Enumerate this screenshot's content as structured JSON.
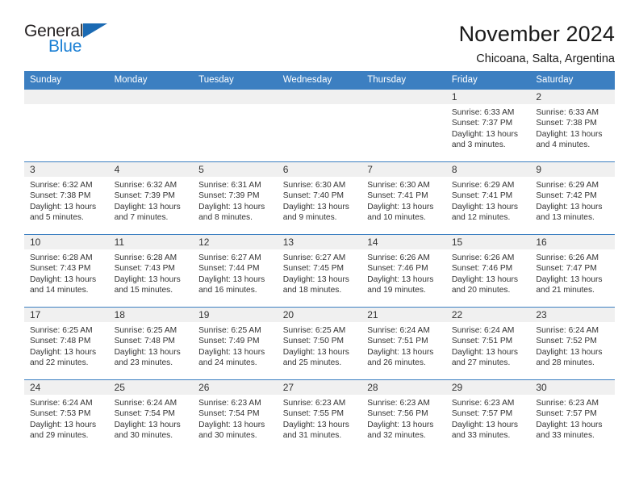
{
  "logo": {
    "word1": "General",
    "word2": "Blue",
    "triangle_color": "#1b6ab3",
    "blue_text_color": "#1a7fd4"
  },
  "header": {
    "title": "November 2024",
    "subtitle": "Chicoana, Salta, Argentina"
  },
  "theme": {
    "header_blue": "#3c7fc1",
    "daynum_gray": "#f0f0f0",
    "text": "#333333"
  },
  "weekdays": [
    "Sunday",
    "Monday",
    "Tuesday",
    "Wednesday",
    "Thursday",
    "Friday",
    "Saturday"
  ],
  "weeks": [
    [
      {
        "day": "",
        "sunrise": "",
        "sunset": "",
        "daylight": ""
      },
      {
        "day": "",
        "sunrise": "",
        "sunset": "",
        "daylight": ""
      },
      {
        "day": "",
        "sunrise": "",
        "sunset": "",
        "daylight": ""
      },
      {
        "day": "",
        "sunrise": "",
        "sunset": "",
        "daylight": ""
      },
      {
        "day": "",
        "sunrise": "",
        "sunset": "",
        "daylight": ""
      },
      {
        "day": "1",
        "sunrise": "Sunrise: 6:33 AM",
        "sunset": "Sunset: 7:37 PM",
        "daylight": "Daylight: 13 hours and 3 minutes."
      },
      {
        "day": "2",
        "sunrise": "Sunrise: 6:33 AM",
        "sunset": "Sunset: 7:38 PM",
        "daylight": "Daylight: 13 hours and 4 minutes."
      }
    ],
    [
      {
        "day": "3",
        "sunrise": "Sunrise: 6:32 AM",
        "sunset": "Sunset: 7:38 PM",
        "daylight": "Daylight: 13 hours and 5 minutes."
      },
      {
        "day": "4",
        "sunrise": "Sunrise: 6:32 AM",
        "sunset": "Sunset: 7:39 PM",
        "daylight": "Daylight: 13 hours and 7 minutes."
      },
      {
        "day": "5",
        "sunrise": "Sunrise: 6:31 AM",
        "sunset": "Sunset: 7:39 PM",
        "daylight": "Daylight: 13 hours and 8 minutes."
      },
      {
        "day": "6",
        "sunrise": "Sunrise: 6:30 AM",
        "sunset": "Sunset: 7:40 PM",
        "daylight": "Daylight: 13 hours and 9 minutes."
      },
      {
        "day": "7",
        "sunrise": "Sunrise: 6:30 AM",
        "sunset": "Sunset: 7:41 PM",
        "daylight": "Daylight: 13 hours and 10 minutes."
      },
      {
        "day": "8",
        "sunrise": "Sunrise: 6:29 AM",
        "sunset": "Sunset: 7:41 PM",
        "daylight": "Daylight: 13 hours and 12 minutes."
      },
      {
        "day": "9",
        "sunrise": "Sunrise: 6:29 AM",
        "sunset": "Sunset: 7:42 PM",
        "daylight": "Daylight: 13 hours and 13 minutes."
      }
    ],
    [
      {
        "day": "10",
        "sunrise": "Sunrise: 6:28 AM",
        "sunset": "Sunset: 7:43 PM",
        "daylight": "Daylight: 13 hours and 14 minutes."
      },
      {
        "day": "11",
        "sunrise": "Sunrise: 6:28 AM",
        "sunset": "Sunset: 7:43 PM",
        "daylight": "Daylight: 13 hours and 15 minutes."
      },
      {
        "day": "12",
        "sunrise": "Sunrise: 6:27 AM",
        "sunset": "Sunset: 7:44 PM",
        "daylight": "Daylight: 13 hours and 16 minutes."
      },
      {
        "day": "13",
        "sunrise": "Sunrise: 6:27 AM",
        "sunset": "Sunset: 7:45 PM",
        "daylight": "Daylight: 13 hours and 18 minutes."
      },
      {
        "day": "14",
        "sunrise": "Sunrise: 6:26 AM",
        "sunset": "Sunset: 7:46 PM",
        "daylight": "Daylight: 13 hours and 19 minutes."
      },
      {
        "day": "15",
        "sunrise": "Sunrise: 6:26 AM",
        "sunset": "Sunset: 7:46 PM",
        "daylight": "Daylight: 13 hours and 20 minutes."
      },
      {
        "day": "16",
        "sunrise": "Sunrise: 6:26 AM",
        "sunset": "Sunset: 7:47 PM",
        "daylight": "Daylight: 13 hours and 21 minutes."
      }
    ],
    [
      {
        "day": "17",
        "sunrise": "Sunrise: 6:25 AM",
        "sunset": "Sunset: 7:48 PM",
        "daylight": "Daylight: 13 hours and 22 minutes."
      },
      {
        "day": "18",
        "sunrise": "Sunrise: 6:25 AM",
        "sunset": "Sunset: 7:48 PM",
        "daylight": "Daylight: 13 hours and 23 minutes."
      },
      {
        "day": "19",
        "sunrise": "Sunrise: 6:25 AM",
        "sunset": "Sunset: 7:49 PM",
        "daylight": "Daylight: 13 hours and 24 minutes."
      },
      {
        "day": "20",
        "sunrise": "Sunrise: 6:25 AM",
        "sunset": "Sunset: 7:50 PM",
        "daylight": "Daylight: 13 hours and 25 minutes."
      },
      {
        "day": "21",
        "sunrise": "Sunrise: 6:24 AM",
        "sunset": "Sunset: 7:51 PM",
        "daylight": "Daylight: 13 hours and 26 minutes."
      },
      {
        "day": "22",
        "sunrise": "Sunrise: 6:24 AM",
        "sunset": "Sunset: 7:51 PM",
        "daylight": "Daylight: 13 hours and 27 minutes."
      },
      {
        "day": "23",
        "sunrise": "Sunrise: 6:24 AM",
        "sunset": "Sunset: 7:52 PM",
        "daylight": "Daylight: 13 hours and 28 minutes."
      }
    ],
    [
      {
        "day": "24",
        "sunrise": "Sunrise: 6:24 AM",
        "sunset": "Sunset: 7:53 PM",
        "daylight": "Daylight: 13 hours and 29 minutes."
      },
      {
        "day": "25",
        "sunrise": "Sunrise: 6:24 AM",
        "sunset": "Sunset: 7:54 PM",
        "daylight": "Daylight: 13 hours and 30 minutes."
      },
      {
        "day": "26",
        "sunrise": "Sunrise: 6:23 AM",
        "sunset": "Sunset: 7:54 PM",
        "daylight": "Daylight: 13 hours and 30 minutes."
      },
      {
        "day": "27",
        "sunrise": "Sunrise: 6:23 AM",
        "sunset": "Sunset: 7:55 PM",
        "daylight": "Daylight: 13 hours and 31 minutes."
      },
      {
        "day": "28",
        "sunrise": "Sunrise: 6:23 AM",
        "sunset": "Sunset: 7:56 PM",
        "daylight": "Daylight: 13 hours and 32 minutes."
      },
      {
        "day": "29",
        "sunrise": "Sunrise: 6:23 AM",
        "sunset": "Sunset: 7:57 PM",
        "daylight": "Daylight: 13 hours and 33 minutes."
      },
      {
        "day": "30",
        "sunrise": "Sunrise: 6:23 AM",
        "sunset": "Sunset: 7:57 PM",
        "daylight": "Daylight: 13 hours and 33 minutes."
      }
    ]
  ]
}
